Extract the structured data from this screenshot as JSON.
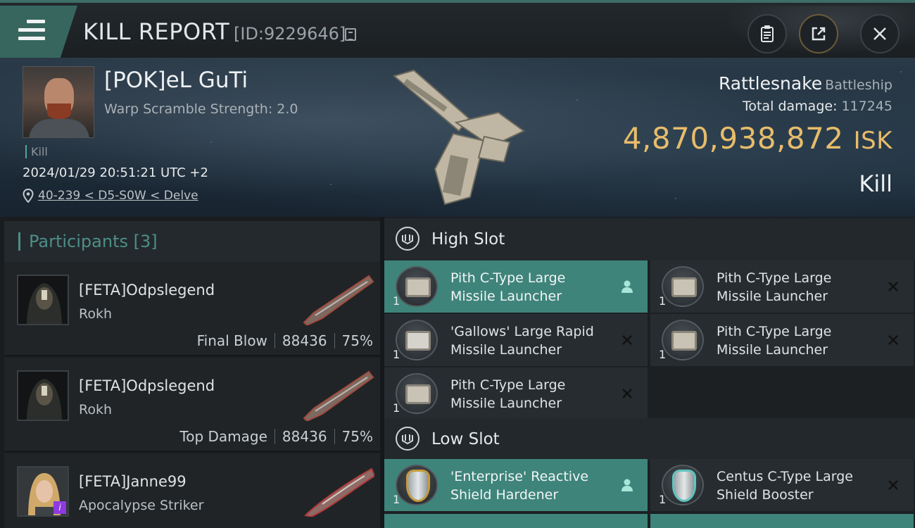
{
  "header": {
    "title": "KILL REPORT",
    "report_id": "[ID:9229646]",
    "icons": {
      "menu": "hamburger-menu-icon",
      "copy": "copy-icon",
      "clipboard": "clipboard-icon",
      "share": "share-icon",
      "close": "close-icon"
    }
  },
  "victim": {
    "name": "[POK]eL GuTi",
    "scramble": "Warp Scramble Strength: 2.0",
    "kill_tag": "Kill",
    "datetime": "2024/01/29 20:51:21 UTC +2",
    "location": "40-239 < D5-S0W < Delve",
    "ship_name": "Rattlesnake",
    "ship_class": "Battleship",
    "total_damage_label": "Total damage:",
    "total_damage": "117245",
    "isk_value": "4,870,938,872",
    "isk_unit": "ISK",
    "result": "Kill"
  },
  "participants": {
    "label": "Participants",
    "count": "[3]",
    "items": [
      {
        "name": "[FETA]Odpslegend",
        "ship": "Rokh",
        "role": "Final Blow",
        "damage": "88436",
        "percent": "75%"
      },
      {
        "name": "[FETA]Odpslegend",
        "ship": "Rokh",
        "role": "Top Damage",
        "damage": "88436",
        "percent": "75%"
      },
      {
        "name": "[FETA]Janne99",
        "ship": "Apocalypse Striker",
        "badge": "i"
      }
    ]
  },
  "fitting": {
    "high_slot": {
      "label": "High Slot",
      "modules": [
        {
          "qty": "1",
          "name": "Pith C-Type Large Missile Launcher",
          "status": "person-icon"
        },
        {
          "qty": "1",
          "name": "Pith C-Type Large Missile Launcher",
          "status": "destroyed-x-icon"
        },
        {
          "qty": "1",
          "name": "'Gallows' Large Rapid Missile Launcher",
          "status": "destroyed-x-icon"
        },
        {
          "qty": "1",
          "name": "Pith C-Type Large Missile Launcher",
          "status": "destroyed-x-icon"
        },
        {
          "qty": "1",
          "name": "Pith C-Type Large Missile Launcher",
          "status": "destroyed-x-icon"
        }
      ]
    },
    "low_slot": {
      "label": "Low Slot",
      "modules": [
        {
          "qty": "1",
          "name": "'Enterprise' Reactive Shield Hardener",
          "status": "person-icon"
        },
        {
          "qty": "1",
          "name": "Centus C-Type Large Shield Booster",
          "status": "destroyed-x-icon"
        }
      ]
    }
  },
  "colors": {
    "accent": "#3e847b",
    "isk": "#e7bc6b",
    "participants_label": "#4d8e88"
  }
}
